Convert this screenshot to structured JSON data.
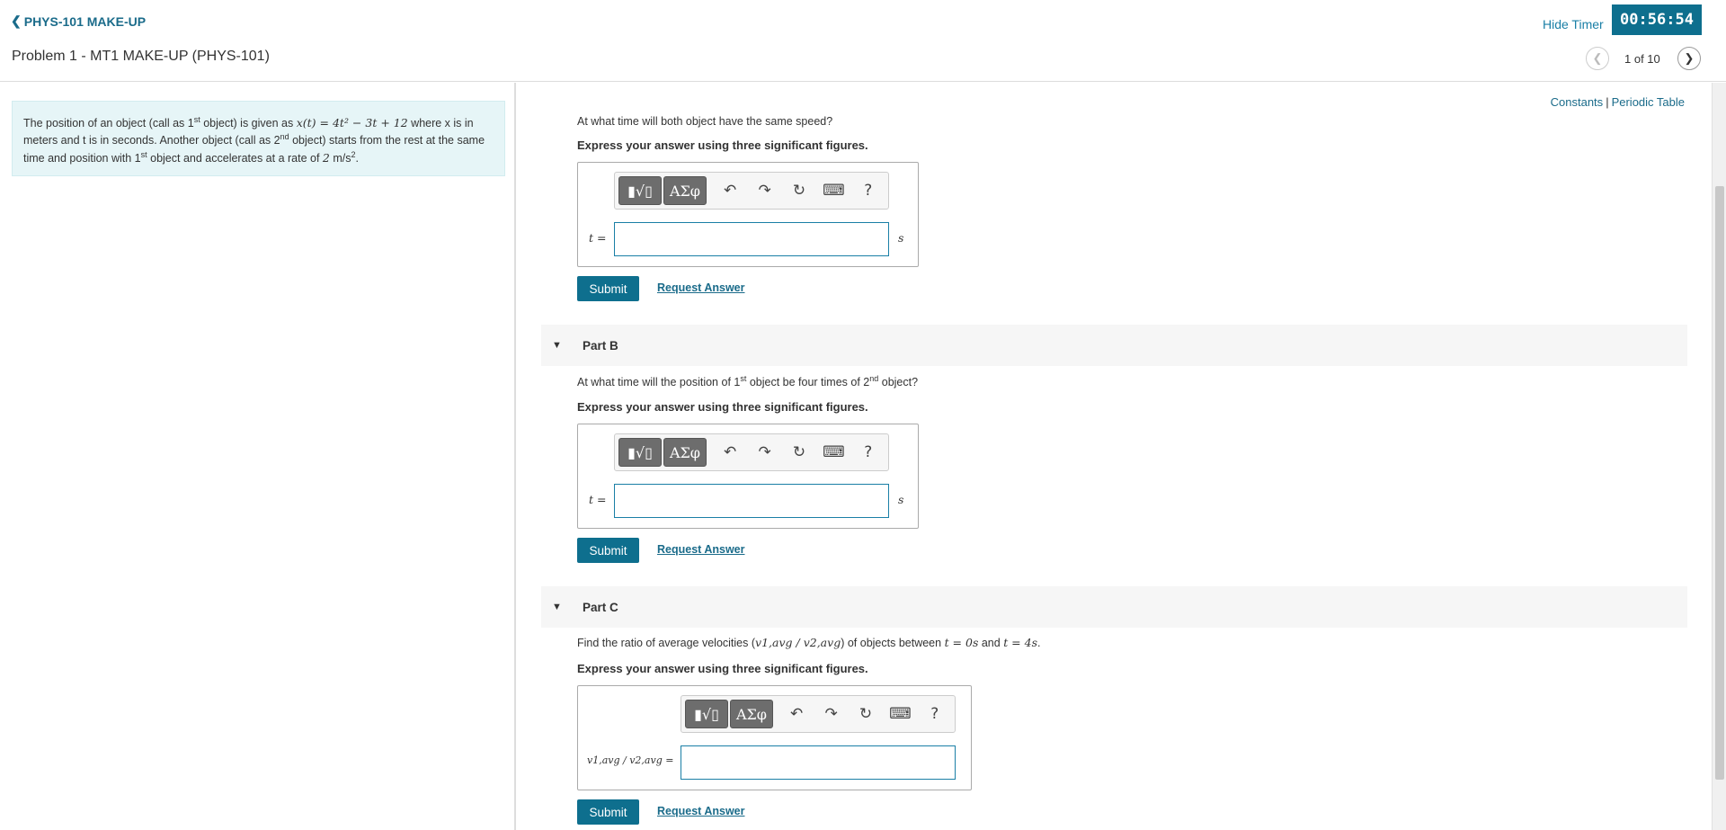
{
  "header": {
    "back_label": "PHYS-101 MAKE-UP",
    "problem_title": "Problem 1 - MT1 MAKE-UP (PHYS-101)",
    "hide_timer": "Hide Timer",
    "timer": "00:56:54",
    "pager": "1 of 10"
  },
  "intro": {
    "p1": "The position of an object (call as 1",
    "st": "st",
    "p2": " object) is given as ",
    "eq": "x(t) = 4t² − 3t + 12",
    "p3": " where x is in meters and t is in seconds. Another object (call as 2",
    "nd": "nd",
    "p4": " object) starts from the rest at the same time and position with 1",
    "p5": " object and accelerates at a rate of ",
    "accel": "2",
    "p6": " m/s",
    "p7": "."
  },
  "links": {
    "constants": "Constants",
    "sep": "|",
    "periodic": "Periodic Table"
  },
  "toolbar": {
    "templates": "▮√▯",
    "greek": "ΑΣφ",
    "undo": "↶",
    "redo": "↷",
    "reset": "↻",
    "keyboard": "⌨",
    "help": "?"
  },
  "partA": {
    "question": "At what time will both object have the same speed?",
    "instruction": "Express your answer using three significant figures.",
    "var": "t =",
    "unit": "s",
    "submit": "Submit",
    "request": "Request Answer"
  },
  "partB": {
    "title": "Part B",
    "q1": "At what time will the position of 1",
    "st": "st",
    "q2": " object be four times of 2",
    "nd": "nd",
    "q3": " object?",
    "instruction": "Express your answer using three significant figures.",
    "var": "t =",
    "unit": "s",
    "submit": "Submit",
    "request": "Request Answer"
  },
  "partC": {
    "title": "Part C",
    "q1": "Find the ratio of average velocities (",
    "ratio": "v1,avg / v2,avg",
    "q2": ") of objects between ",
    "t0": "t = 0s",
    "q3": " and ",
    "t4": "t = 4s",
    "q4": ".",
    "instruction": "Express your answer using three significant figures.",
    "var": "v1,avg / v2,avg =",
    "submit": "Submit",
    "request": "Request Answer"
  }
}
